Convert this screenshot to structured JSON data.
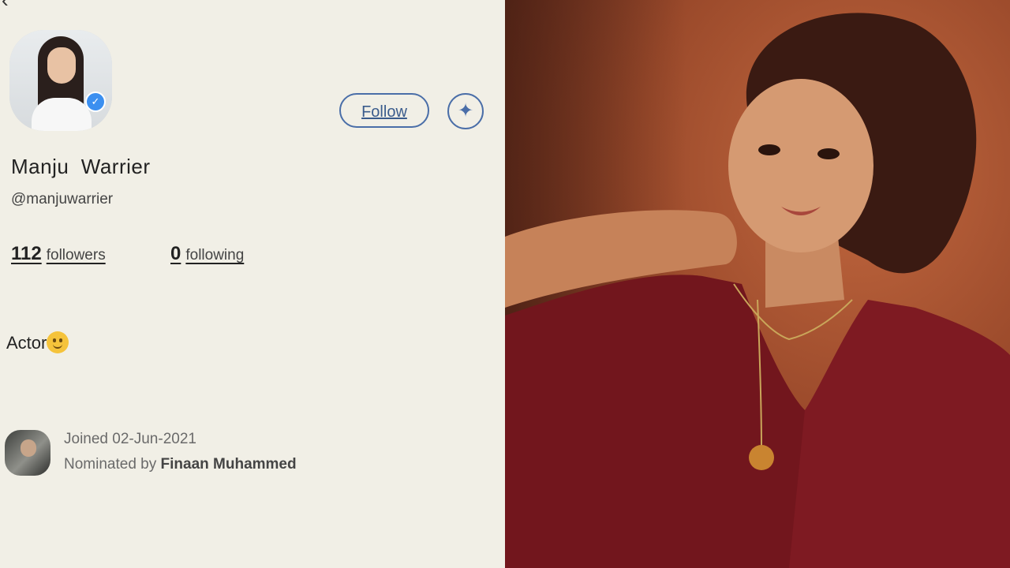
{
  "profile": {
    "back_icon": "‹",
    "name": "Manju  Warrier",
    "handle": "@manjuwarrier",
    "follow_label": "Follow",
    "sparkle_icon": "✦",
    "verified_icon": "✓",
    "followers": {
      "count": "112",
      "label": "followers"
    },
    "following": {
      "count": "0",
      "label": "following"
    },
    "bio": "Actor",
    "joined": "Joined 02-Jun-2021",
    "nominated_prefix": "Nominated by",
    "nominator": "Finaan Muhammed"
  },
  "colors": {
    "background": "#f1efe6",
    "accent": "#4a6ea8",
    "verified": "#3b8ff0"
  }
}
